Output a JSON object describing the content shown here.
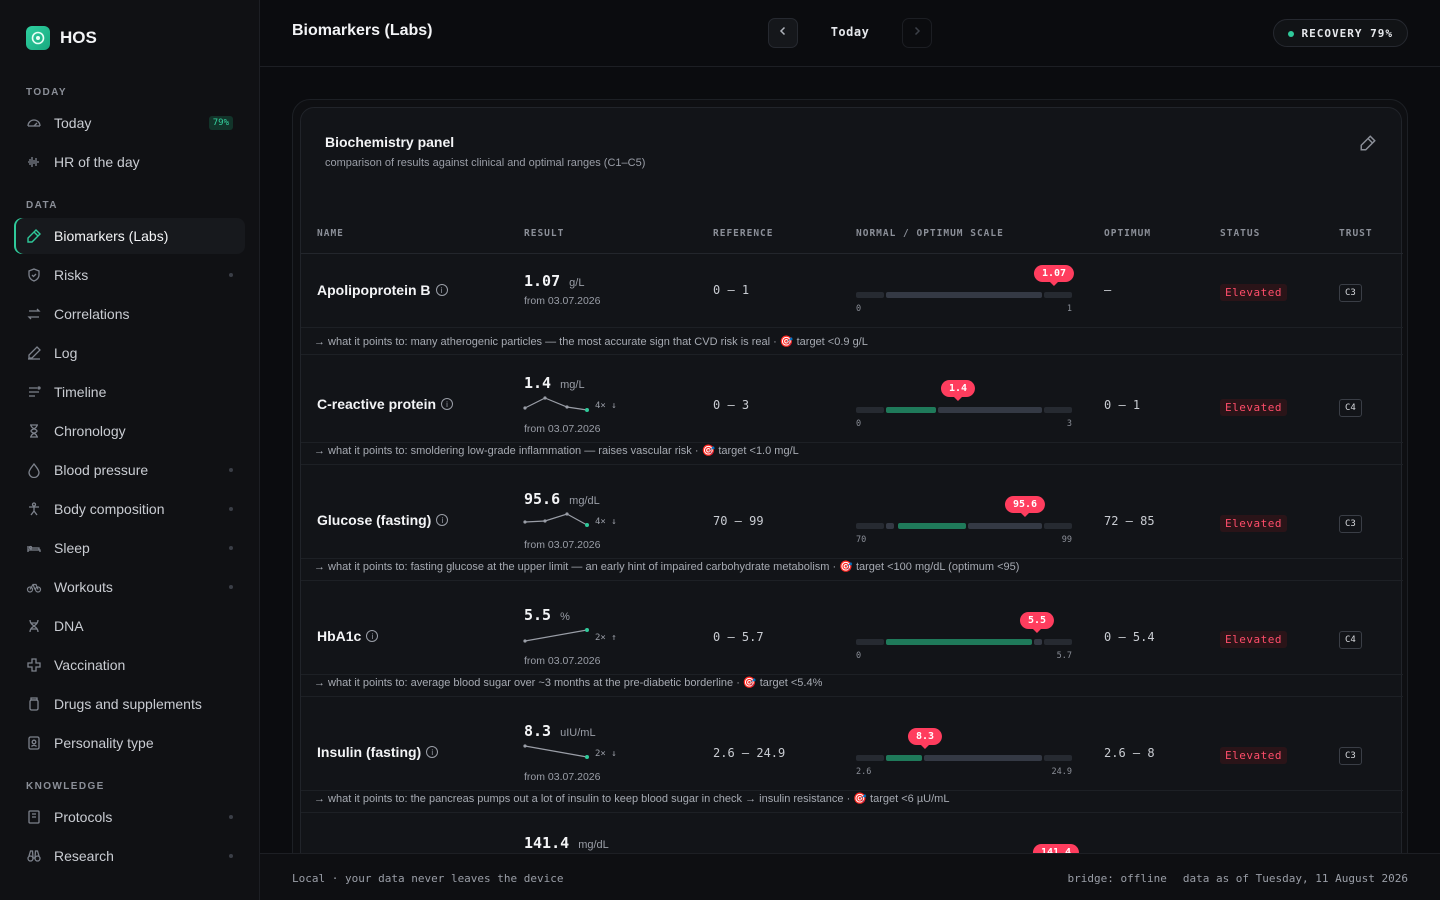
{
  "app": {
    "name": "HOS"
  },
  "sidebar": {
    "sections": {
      "today": "TODAY",
      "data": "DATA",
      "knowledge": "KNOWLEDGE"
    },
    "today_items": [
      {
        "label": "Today",
        "badge": "79%"
      },
      {
        "label": "HR of the day"
      }
    ],
    "data_items": [
      {
        "label": "Biomarkers (Labs)"
      },
      {
        "label": "Risks"
      },
      {
        "label": "Correlations"
      },
      {
        "label": "Log"
      },
      {
        "label": "Timeline"
      },
      {
        "label": "Chronology"
      },
      {
        "label": "Blood pressure"
      },
      {
        "label": "Body composition"
      },
      {
        "label": "Sleep"
      },
      {
        "label": "Workouts"
      },
      {
        "label": "DNA"
      },
      {
        "label": "Vaccination"
      },
      {
        "label": "Drugs and supplements"
      },
      {
        "label": "Personality type"
      }
    ],
    "knowledge_items": [
      {
        "label": "Protocols"
      },
      {
        "label": "Research"
      }
    ]
  },
  "header": {
    "title": "Biomarkers (Labs)",
    "date": "Today",
    "recovery": "RECOVERY 79%"
  },
  "panel": {
    "title": "Biochemistry panel",
    "subtitle": "comparison of results against clinical and optimal ranges (C1–C5)",
    "columns": {
      "name": "NAME",
      "result": "RESULT",
      "reference": "REFERENCE",
      "scale": "NORMAL / OPTIMUM SCALE",
      "optimum": "OPTIMUM",
      "status": "STATUS",
      "trust": "TRUST"
    },
    "rows": [
      {
        "name": "Apolipoprotein B",
        "value": "1.07",
        "unit": "g/L",
        "from": "from 03.07.2026",
        "trend": "",
        "reference": "0 – 1",
        "scale_min": "0",
        "scale_max": "1",
        "bubble": "1.07",
        "optimum": "—",
        "status": "Elevated",
        "trust": "C3",
        "note": "→ what it points to: many atherogenic particles — the most accurate sign that CVD risk is real · 🎯 target <0.9 g/L"
      },
      {
        "name": "C-reactive protein",
        "value": "1.4",
        "unit": "mg/L",
        "from": "from 03.07.2026",
        "trend": "4× ↓",
        "reference": "0 – 3",
        "scale_min": "0",
        "scale_max": "3",
        "bubble": "1.4",
        "optimum": "0 – 1",
        "status": "Elevated",
        "trust": "C4",
        "note": "→ what it points to: smoldering low-grade inflammation — raises vascular risk · 🎯 target <1.0 mg/L"
      },
      {
        "name": "Glucose (fasting)",
        "value": "95.6",
        "unit": "mg/dL",
        "from": "from 03.07.2026",
        "trend": "4× ↓",
        "reference": "70 – 99",
        "scale_min": "70",
        "scale_max": "99",
        "bubble": "95.6",
        "optimum": "72 – 85",
        "status": "Elevated",
        "trust": "C3",
        "note": "→ what it points to: fasting glucose at the upper limit — an early hint of impaired carbohydrate metabolism · 🎯 target <100 mg/dL (optimum <95)"
      },
      {
        "name": "HbA1c",
        "value": "5.5",
        "unit": "%",
        "from": "from 03.07.2026",
        "trend": "2× ↑",
        "reference": "0 – 5.7",
        "scale_min": "0",
        "scale_max": "5.7",
        "bubble": "5.5",
        "optimum": "0 – 5.4",
        "status": "Elevated",
        "trust": "C4",
        "note": "→ what it points to: average blood sugar over ~3 months at the pre-diabetic borderline · 🎯 target <5.4%"
      },
      {
        "name": "Insulin (fasting)",
        "value": "8.3",
        "unit": "uIU/mL",
        "from": "from 03.07.2026",
        "trend": "2× ↓",
        "reference": "2.6 – 24.9",
        "scale_min": "2.6",
        "scale_max": "24.9",
        "bubble": "8.3",
        "optimum": "2.6 – 8",
        "status": "Elevated",
        "trust": "C3",
        "note": "→ what it points to: the pancreas pumps out a lot of insulin to keep blood sugar in check → insulin resistance · 🎯 target <6 µU/mL"
      },
      {
        "name": "",
        "value": "141.4",
        "unit": "mg/dL",
        "bubble": "141.4"
      }
    ]
  },
  "footer": {
    "left": "Local · your data never leaves the device",
    "bridge": "bridge: offline",
    "data_as_of": "data as of Tuesday, 11 August 2026"
  },
  "colors": {
    "accent": "#2fc99a",
    "danger": "#ff3d5e"
  }
}
